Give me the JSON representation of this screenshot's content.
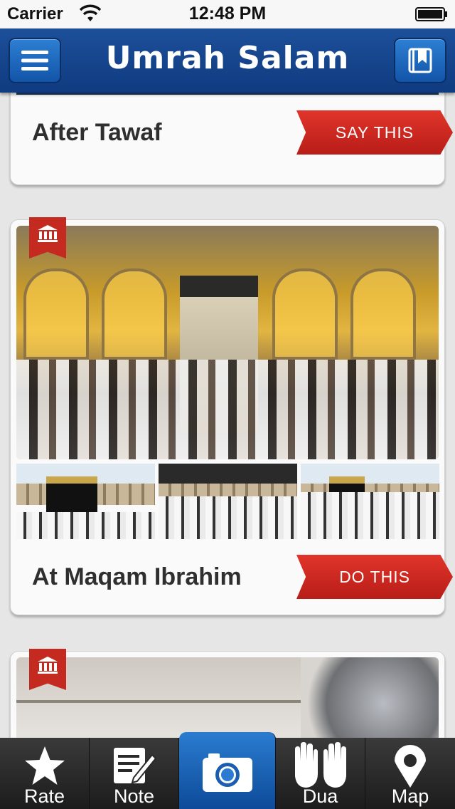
{
  "status_bar": {
    "carrier": "Carrier",
    "time": "12:48 PM"
  },
  "nav": {
    "title": "Umrah Salam",
    "menu_icon": "menu-icon",
    "bookmark_icon": "bookmark-icon"
  },
  "cards": [
    {
      "title": "After Tawaf",
      "action": "SAY THIS"
    },
    {
      "title": "At Maqam Ibrahim",
      "action": "DO THIS",
      "badge_icon": "mosque-icon"
    },
    {
      "badge_icon": "mosque-icon"
    }
  ],
  "tabs": [
    {
      "label": "Rate",
      "icon": "star-icon"
    },
    {
      "label": "Note",
      "icon": "note-icon"
    },
    {
      "label": "",
      "icon": "camera-icon"
    },
    {
      "label": "Dua",
      "icon": "hands-icon"
    },
    {
      "label": "Map",
      "icon": "map-pin-icon"
    }
  ],
  "colors": {
    "nav": "#1d4f9a",
    "ribbon": "#c42a1f",
    "camera_tab": "#1e68bb"
  }
}
